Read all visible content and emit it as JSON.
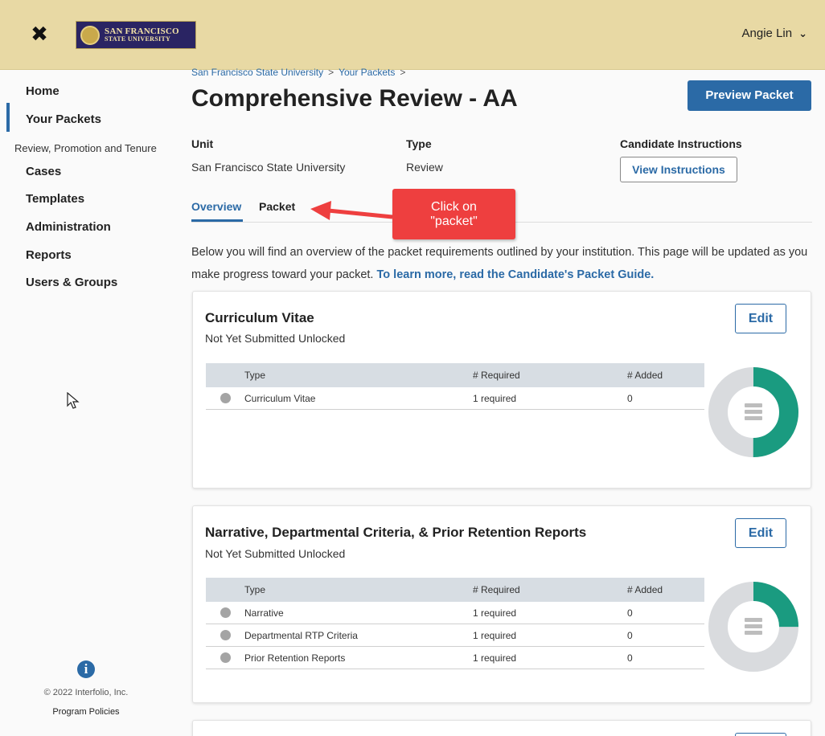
{
  "header": {
    "logo_line1": "SAN FRANCISCO",
    "logo_line2": "STATE UNIVERSITY",
    "user_name": "Angie Lin"
  },
  "sidebar": {
    "items": [
      {
        "label": "Home"
      },
      {
        "label": "Your Packets"
      },
      {
        "label": "Cases"
      },
      {
        "label": "Templates"
      },
      {
        "label": "Administration"
      },
      {
        "label": "Reports"
      },
      {
        "label": "Users & Groups"
      }
    ],
    "group_label": "Review, Promotion and Tenure",
    "copyright": "© 2022 Interfolio, Inc.",
    "policies": "Program Policies"
  },
  "breadcrumb": {
    "item1": "San Francisco State University",
    "item2": "Your Packets",
    "sep": ">"
  },
  "page": {
    "title": "Comprehensive Review - AA",
    "preview_button": "Preview Packet",
    "unit_label": "Unit",
    "unit_value": "San Francisco State University",
    "type_label": "Type",
    "type_value": "Review",
    "instructions_label": "Candidate Instructions",
    "instructions_button": "View Instructions"
  },
  "tabs": {
    "overview": "Overview",
    "packet": "Packet"
  },
  "intro": {
    "text1": "Below you will find an overview of the packet requirements outlined by your institution. This page will be updated as you make progress toward your packet. ",
    "link": "To learn more, read the Candidate's Packet Guide."
  },
  "callout": {
    "line1": "Click on",
    "line2": "\"packet\""
  },
  "table_headers": {
    "type": "Type",
    "required": "# Required",
    "added": "# Added"
  },
  "cards": [
    {
      "title": "Curriculum Vitae",
      "status": "Not Yet Submitted Unlocked",
      "edit": "Edit",
      "rows": [
        {
          "type": "Curriculum Vitae",
          "required": "1 required",
          "added": "0"
        }
      ],
      "progress": 0.5
    },
    {
      "title": "Narrative, Departmental Criteria, & Prior Retention Reports",
      "status": "Not Yet Submitted Unlocked",
      "edit": "Edit",
      "rows": [
        {
          "type": "Narrative",
          "required": "1 required",
          "added": "0"
        },
        {
          "type": "Departmental RTP Criteria",
          "required": "1 required",
          "added": "0"
        },
        {
          "type": "Prior Retention Reports",
          "required": "1 required",
          "added": "0"
        }
      ],
      "progress": 0.25
    }
  ],
  "colors": {
    "header_bg": "#e8d9a4",
    "accent": "#2b6aa6",
    "donut_fill": "#1a9b80",
    "donut_track": "#d9dbde",
    "callout": "#ee3f3f"
  }
}
